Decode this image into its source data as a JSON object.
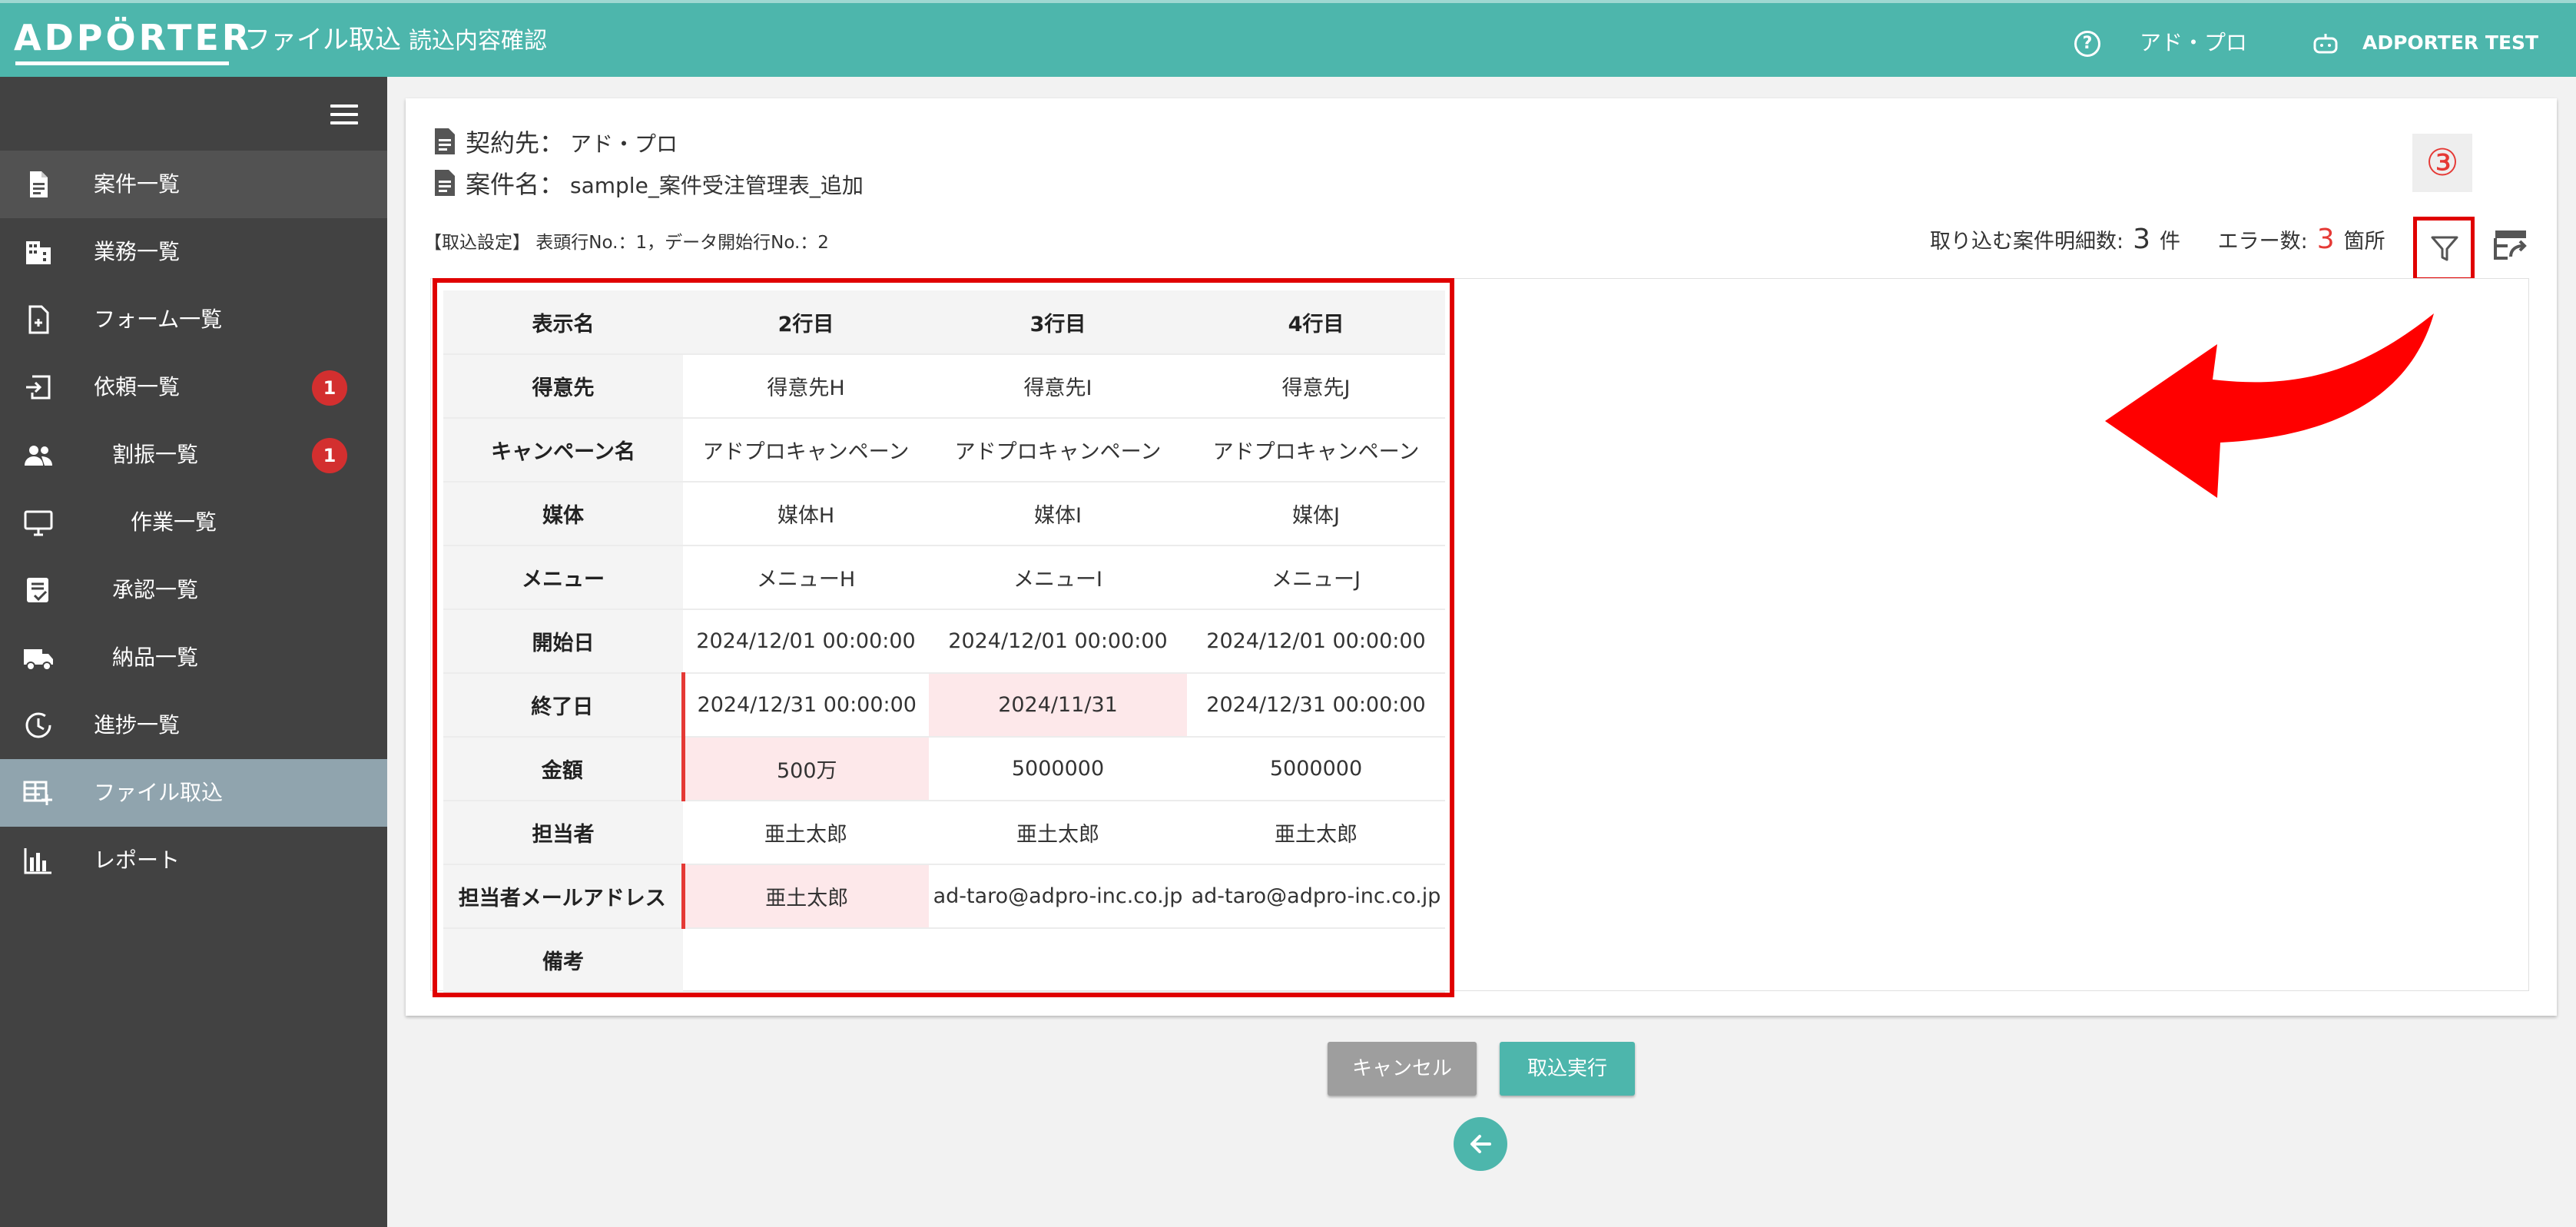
{
  "header": {
    "logo": "ADPÖRTER",
    "title": "ファイル取込",
    "subtitle": "読込内容確認",
    "user_org": "アド・プロ",
    "user_name": "ADPORTER TEST"
  },
  "sidebar": {
    "items": [
      {
        "label": "案件一覧",
        "icon": "document-icon"
      },
      {
        "label": "業務一覧",
        "icon": "building-icon"
      },
      {
        "label": "フォーム一覧",
        "icon": "form-icon"
      },
      {
        "label": "依頼一覧",
        "icon": "inbox-icon",
        "badge": "1"
      },
      {
        "label": "割振一覧",
        "icon": "people-icon",
        "badge": "1"
      },
      {
        "label": "作業一覧",
        "icon": "monitor-icon"
      },
      {
        "label": "承認一覧",
        "icon": "approve-icon"
      },
      {
        "label": "納品一覧",
        "icon": "truck-icon"
      },
      {
        "label": "進捗一覧",
        "icon": "clock-icon"
      },
      {
        "label": "ファイル取込",
        "icon": "table-add-icon"
      },
      {
        "label": "レポート",
        "icon": "bar-chart-icon"
      }
    ]
  },
  "info": {
    "client_label": "契約先：",
    "client_value": "アド・プロ",
    "case_label": "案件名：",
    "case_value": "sample_案件受注管理表_追加",
    "settings": "【取込設定】 表頭行No.：1，データ開始行No.：2"
  },
  "annotation": {
    "step": "③"
  },
  "counts": {
    "rows_label": "取り込む案件明細数:",
    "rows_value": "3",
    "rows_unit": "件",
    "errors_label": "エラー数:",
    "errors_value": "3",
    "errors_unit": "箇所"
  },
  "table": {
    "headers": [
      "表示名",
      "2行目",
      "3行目",
      "4行目"
    ],
    "rows": [
      {
        "name": "得意先",
        "cells": [
          "得意先H",
          "得意先I",
          "得意先J"
        ]
      },
      {
        "name": "キャンペーン名",
        "cells": [
          "アドプロキャンペーン",
          "アドプロキャンペーン",
          "アドプロキャンペーン"
        ]
      },
      {
        "name": "媒体",
        "cells": [
          "媒体H",
          "媒体I",
          "媒体J"
        ]
      },
      {
        "name": "メニュー",
        "cells": [
          "メニューH",
          "メニューI",
          "メニューJ"
        ]
      },
      {
        "name": "開始日",
        "cells": [
          "2024/12/01 00:00:00",
          "2024/12/01 00:00:00",
          "2024/12/01 00:00:00"
        ]
      },
      {
        "name": "終了日",
        "cells": [
          "2024/12/31 00:00:00",
          "2024/11/31",
          "2024/12/31 00:00:00"
        ]
      },
      {
        "name": "金額",
        "cells": [
          "500万",
          "5000000",
          "5000000"
        ]
      },
      {
        "name": "担当者",
        "cells": [
          "亜土太郎",
          "亜土太郎",
          "亜土太郎"
        ]
      },
      {
        "name": "担当者メールアドレス",
        "cells": [
          "亜土太郎",
          "ad-taro@adpro-inc.co.jp",
          "ad-taro@adpro-inc.co.jp"
        ]
      },
      {
        "name": "備考",
        "cells": [
          "",
          "",
          ""
        ]
      }
    ]
  },
  "buttons": {
    "cancel": "キャンセル",
    "execute": "取込実行"
  },
  "colors": {
    "primary": "#4db6ac",
    "sidebar": "#424242",
    "sidebar_selected": "#90a4ae",
    "error": "#e53935",
    "error_bg": "#fde8ea",
    "annotation_red": "#e00000"
  }
}
